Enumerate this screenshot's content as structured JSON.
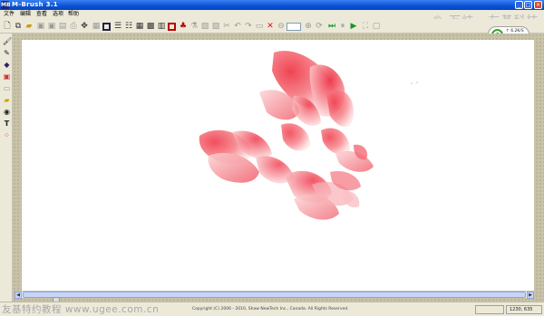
{
  "window": {
    "app_icon": "MB",
    "title": "M-Brush 3.1",
    "controls": {
      "minimize": "_",
      "maximize": "□",
      "close": "×"
    }
  },
  "menu": [
    {
      "label": "文件"
    },
    {
      "label": "编辑"
    },
    {
      "label": "查看"
    },
    {
      "label": "选项"
    },
    {
      "label": "帮助"
    }
  ],
  "watermark_top": "© 万岐 · 友基科技",
  "net_widget": {
    "icon": "network-icon",
    "upload": "↑ 6.2K/S",
    "download": "↓ 8.9K/S"
  },
  "status": {
    "copyright": "Copyright (C) 2006 - 2010, Shaw NewTech Inc., Canada.  All Rights Reserved.",
    "coords": "1230, 635"
  },
  "watermark_bottom": "友基特约教程  www.ugee.com.cn"
}
